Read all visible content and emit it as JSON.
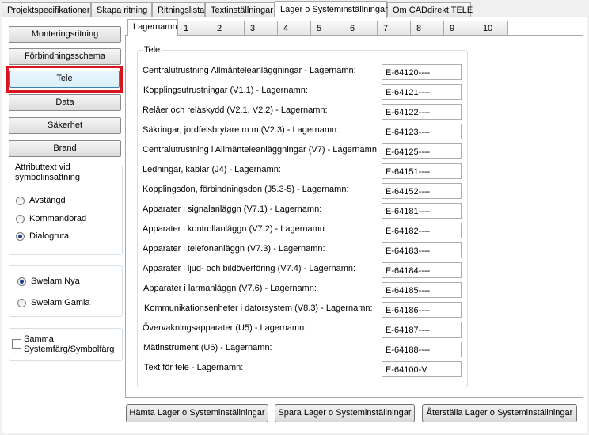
{
  "top_tabs": [
    "Projektspecifikationer",
    "Skapa ritning",
    "Ritningslista",
    "Textinställningar",
    "Lager o Systeminställningar",
    "Om CADdirekt TELE"
  ],
  "left_buttons": [
    "Monteringsritning",
    "Förbindningsschema",
    "Tele",
    "Data",
    "Säkerhet",
    "Brand"
  ],
  "attribute_group": {
    "title": "Attributtext vid symbolinsattning",
    "options": [
      "Avstängd",
      "Kommandorad",
      "Dialogruta"
    ],
    "selected": "Dialogruta"
  },
  "swelam_group": {
    "options": [
      "Swelam Nya",
      "Swelam Gamla"
    ],
    "selected": "Swelam Nya"
  },
  "color_checkbox": {
    "label": "Samma Systemfärg/Symbolfärg",
    "checked": false
  },
  "inner_tabs": [
    "Lagernamn",
    "1",
    "2",
    "3",
    "4",
    "5",
    "6",
    "7",
    "8",
    "9",
    "10"
  ],
  "group_title": "Tele",
  "rows": [
    {
      "label": "Centralutrustning Allmänteleanläggningar - Lagernamn:",
      "value": "E-64120----"
    },
    {
      "label": "Kopplingsutrustningar (V1.1) - Lagernamn:",
      "value": "E-64121----"
    },
    {
      "label": "Reläer och reläskydd (V2.1, V2.2) - Lagernamn:",
      "value": "E-64122----"
    },
    {
      "label": "Säkringar, jordfelsbrytare m m (V2.3) - Lagernamn:",
      "value": "E-64123----"
    },
    {
      "label": "Centralutrustning i Allmänteleanläggningar (V7) - Lagernamn:",
      "value": "E-64125----"
    },
    {
      "label": "Ledningar, kablar (J4) - Lagernamn:",
      "value": "E-64151----"
    },
    {
      "label": "Kopplingsdon, förbindningsdon (J5.3-5) - Lagernamn:",
      "value": "E-64152----"
    },
    {
      "label": "Apparater i signalanläggn (V7.1) - Lagernamn:",
      "value": "E-64181----"
    },
    {
      "label": "Apparater i kontrollanläggn (V7.2) - Lagernamn:",
      "value": "E-64182----"
    },
    {
      "label": "Apparater i telefonanläggn (V7.3) - Lagernamn:",
      "value": "E-64183----"
    },
    {
      "label": "Apparater i ljud- och bildöverföring (V7.4) - Lagernamn:",
      "value": "E-64184----"
    },
    {
      "label": "Apparater i larmanläggn (V7.6) - Lagernamn:",
      "value": "E-64185----"
    },
    {
      "label": "Kommunikationsenheter i datorsystem (V8.3) - Lagernamn:",
      "value": "E-64186----"
    },
    {
      "label": "Övervakningsapparater (U5) - Lagernamn:",
      "value": "E-64187----"
    },
    {
      "label": "Mätinstrument (U6) - Lagernamn:",
      "value": "E-64188----"
    },
    {
      "label": "Text för tele - Lagernamn:",
      "value": "E-64100-V"
    }
  ],
  "bottom_buttons": [
    "Hämta Lager o Systeminställningar",
    "Spara Lager o Systeminställningar",
    "Återställa Lager o Systeminställningar"
  ],
  "colors": {
    "highlight": "#d8141e",
    "radio_fill": "#1e3f8c"
  }
}
